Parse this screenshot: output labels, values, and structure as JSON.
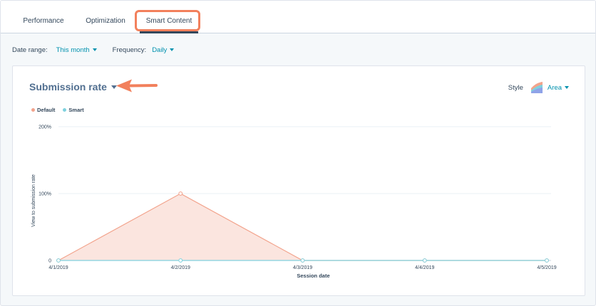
{
  "tabs": [
    {
      "label": "Performance",
      "active": false
    },
    {
      "label": "Optimization",
      "active": false
    },
    {
      "label": "Smart Content",
      "active": true
    }
  ],
  "filters": {
    "date_range_label": "Date range:",
    "date_range_value": "This month",
    "frequency_label": "Frequency:",
    "frequency_value": "Daily"
  },
  "card": {
    "title": "Submission rate",
    "style_label": "Style",
    "style_value": "Area"
  },
  "colors": {
    "accent": "#0091ae",
    "highlight": "#f2805c",
    "default_series": "#f2a38c",
    "smart_series": "#7fd1de"
  },
  "chart_data": {
    "type": "area",
    "x": [
      "4/1/2019",
      "4/2/2019",
      "4/3/2019",
      "4/4/2019",
      "4/5/2019"
    ],
    "series": [
      {
        "name": "Default",
        "values": [
          0,
          100,
          0,
          0,
          0
        ]
      },
      {
        "name": "Smart",
        "values": [
          0,
          0,
          0,
          0,
          0
        ]
      }
    ],
    "y_ticks": [
      "0",
      "100%",
      "200%"
    ],
    "ylim": [
      0,
      200
    ],
    "xlabel": "Session date",
    "ylabel": "View to submission rate",
    "legend_position": "top-left",
    "grid": true
  }
}
